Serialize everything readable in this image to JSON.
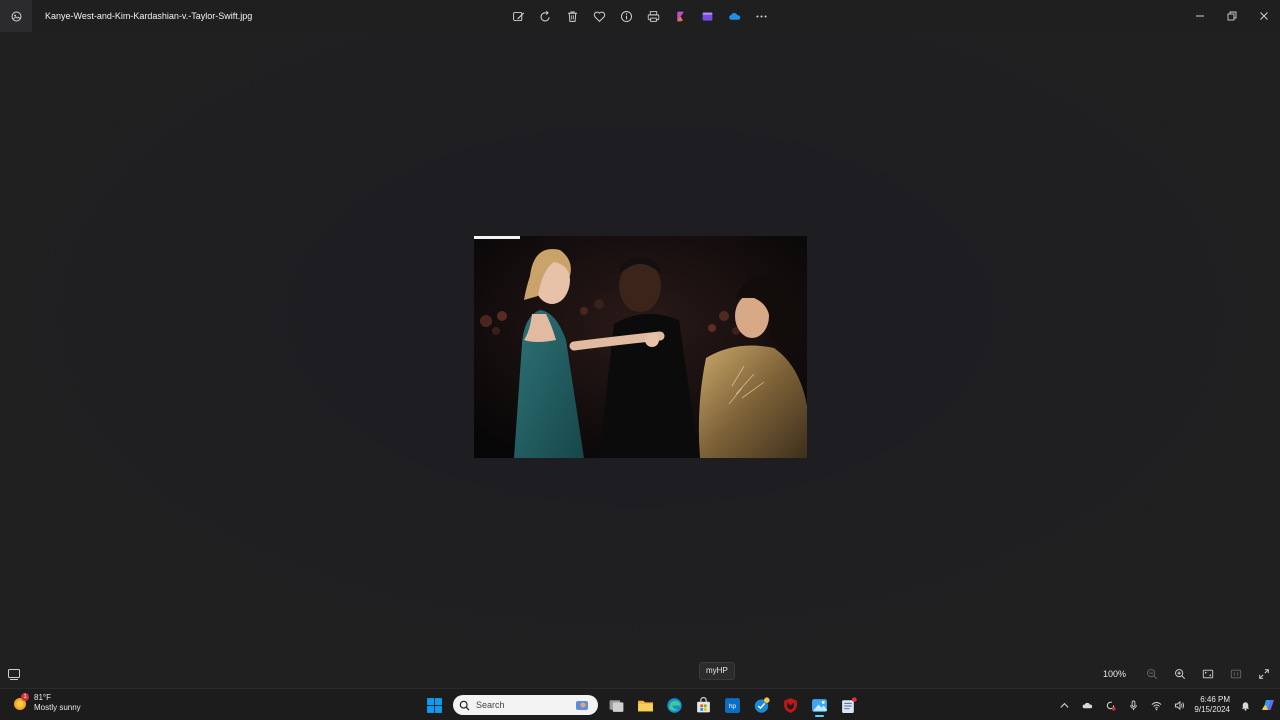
{
  "window": {
    "file_name": "Kanye-West-and-Kim-Kardashian-v.-Taylor-Swift.jpg"
  },
  "toolbar": {
    "items": [
      {
        "name": "edit-image-button",
        "icon": "edit-icon"
      },
      {
        "name": "rotate-button",
        "icon": "rotate-icon"
      },
      {
        "name": "delete-button",
        "icon": "trash-icon"
      },
      {
        "name": "favorite-button",
        "icon": "heart-icon"
      },
      {
        "name": "file-info-button",
        "icon": "info-icon"
      },
      {
        "name": "print-button",
        "icon": "printer-icon"
      },
      {
        "name": "designer-button",
        "icon": "designer-icon"
      },
      {
        "name": "clipchamp-button",
        "icon": "clipchamp-icon"
      },
      {
        "name": "onedrive-button",
        "icon": "onedrive-icon"
      },
      {
        "name": "more-options-button",
        "icon": "ellipsis-icon"
      }
    ]
  },
  "statusbar": {
    "tooltip": "myHP",
    "zoom_level": "100%"
  },
  "taskbar": {
    "weather": {
      "temperature": "81°F",
      "condition": "Mostly sunny",
      "badge": "1"
    },
    "search_placeholder": "Search",
    "clock": {
      "time": "6:46 PM",
      "date": "9/15/2024"
    }
  },
  "colors": {
    "background": "#1f1f20",
    "accent": "#60cdff",
    "windows_blue": "#0f9bf0"
  }
}
